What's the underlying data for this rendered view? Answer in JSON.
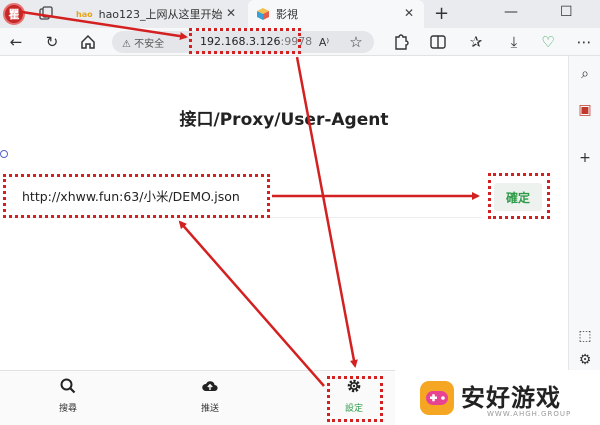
{
  "browser": {
    "profile_initial": "瞿",
    "tabs": [
      {
        "label": "hao123_上网从这里开始",
        "favicon": "hao123-logo",
        "favicon_text": "hao"
      },
      {
        "label": "影視",
        "favicon": "cube-icon",
        "active": true
      }
    ],
    "new_tab_label": "+",
    "window_controls": {
      "minimize": "—",
      "maximize": "☐"
    }
  },
  "navbar": {
    "insecure_label": "不安全",
    "url_host": "192.168.3.126",
    "url_port": ":9978"
  },
  "page": {
    "title": "接口/Proxy/User-Agent",
    "input_value": "http://xhww.fun:63/小米/DEMO.json",
    "confirm_label": "確定"
  },
  "bottom_nav": [
    {
      "label": "搜尋",
      "icon": "search-icon"
    },
    {
      "label": "推送",
      "icon": "cloud-upload-icon"
    },
    {
      "label": "設定",
      "icon": "gear-icon",
      "active": true
    }
  ],
  "watermark": {
    "text": "安好游戏",
    "sub": "WWW.AHGH.GROUP"
  },
  "colors": {
    "annotation": "#d32020",
    "accent": "#2e9b4a"
  }
}
